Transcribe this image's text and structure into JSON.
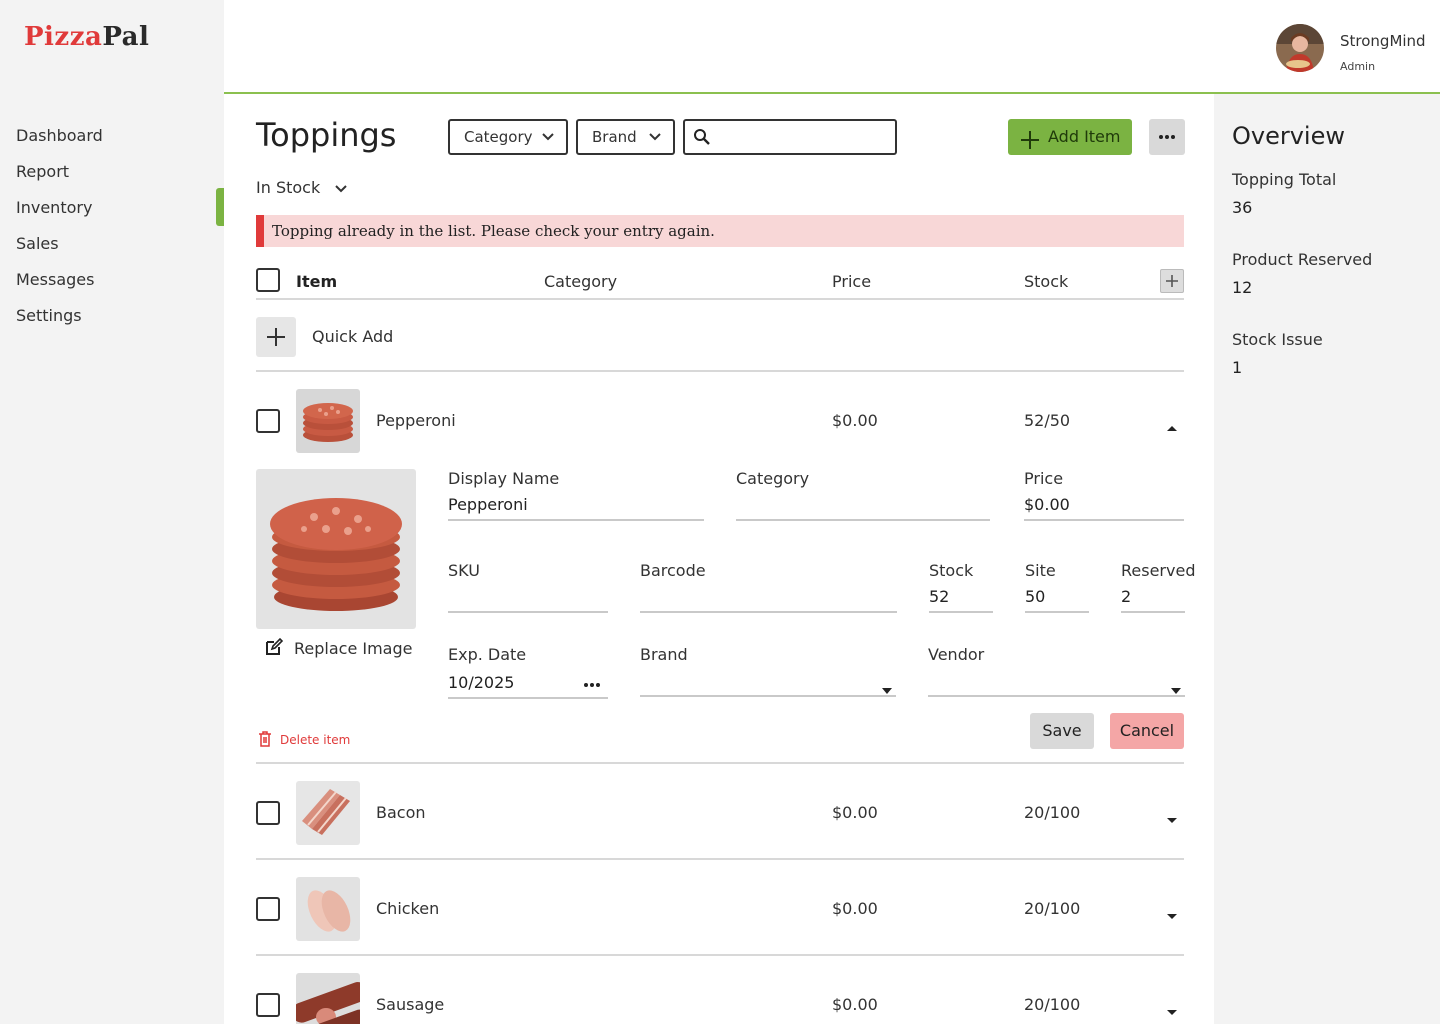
{
  "brand": {
    "name_part1": "Pizza",
    "name_part2": "Pal",
    "accent": "#7bb342",
    "red": "#e03a3a"
  },
  "user": {
    "name": "StrongMind",
    "role": "Admin"
  },
  "sidebar": {
    "items": [
      {
        "label": "Dashboard"
      },
      {
        "label": "Report"
      },
      {
        "label": "Inventory",
        "active": true
      },
      {
        "label": "Sales"
      },
      {
        "label": "Messages"
      },
      {
        "label": "Settings"
      }
    ]
  },
  "main": {
    "title": "Toppings",
    "filters": {
      "category": "Category",
      "brand": "Brand",
      "search_placeholder": ""
    },
    "add_label": "Add Item",
    "stock_filter": "In Stock",
    "alert": "Topping already in the list. Please check your entry again.",
    "columns": {
      "item": "Item",
      "category": "Category",
      "price": "Price",
      "stock": "Stock"
    },
    "quick_add": "Quick Add",
    "rows": [
      {
        "name": "Pepperoni",
        "price": "$0.00",
        "stock": "52/50",
        "expanded": true
      },
      {
        "name": "Bacon",
        "price": "$0.00",
        "stock": "20/100"
      },
      {
        "name": "Chicken",
        "price": "$0.00",
        "stock": "20/100"
      },
      {
        "name": "Sausage",
        "price": "$0.00",
        "stock": "20/100"
      }
    ],
    "detail": {
      "replace_image": "Replace Image",
      "display_name_label": "Display Name",
      "display_name": "Pepperoni",
      "category_label": "Category",
      "category": "",
      "price_label": "Price",
      "price": "$0.00",
      "sku_label": "SKU",
      "sku": "",
      "barcode_label": "Barcode",
      "barcode": "",
      "stock_label": "Stock",
      "stock": "52",
      "site_label": "Site",
      "site": "50",
      "reserved_label": "Reserved",
      "reserved": "2",
      "exp_label": "Exp. Date",
      "exp": "10/2025",
      "brand_label": "Brand",
      "brand": "",
      "vendor_label": "Vendor",
      "vendor": "",
      "delete_label": "Delete item",
      "save_label": "Save",
      "cancel_label": "Cancel"
    }
  },
  "overview": {
    "title": "Overview",
    "stats": [
      {
        "label": "Topping Total",
        "value": "36"
      },
      {
        "label": "Product Reserved",
        "value": "12"
      },
      {
        "label": "Stock Issue",
        "value": "1"
      }
    ]
  }
}
